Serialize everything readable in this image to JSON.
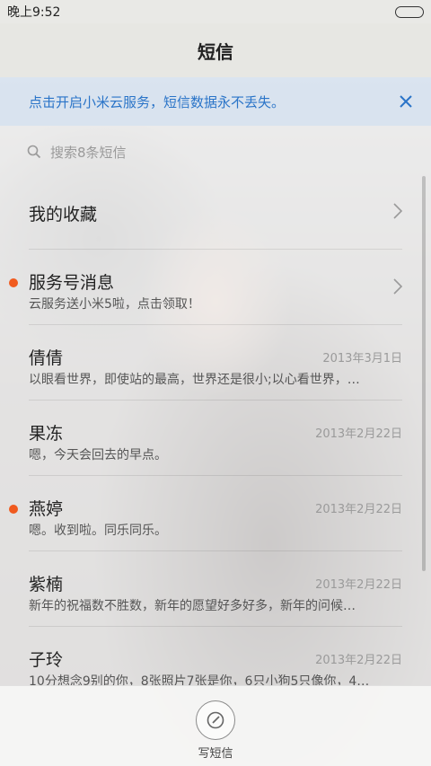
{
  "status": {
    "time": "晚上9:52",
    "battery": 1.0
  },
  "header": {
    "title": "短信"
  },
  "banner": {
    "text": "点击开启小米云服务，短信数据永不丢失。"
  },
  "search": {
    "placeholder": "搜索8条短信"
  },
  "conversations": [
    {
      "name": "我的收藏",
      "date": "",
      "preview": "",
      "unread": false,
      "chevron": true
    },
    {
      "name": "服务号消息",
      "date": "",
      "preview": "云服务送小米5啦，点击领取！",
      "unread": true,
      "chevron": true
    },
    {
      "name": "倩倩",
      "date": "2013年3月1日",
      "preview": "以眼看世界，即使站的最高，世界还是很小;以心看世界，…",
      "unread": false,
      "chevron": false
    },
    {
      "name": "果冻",
      "date": "2013年2月22日",
      "preview": "嗯，今天会回去的早点。",
      "unread": false,
      "chevron": false
    },
    {
      "name": "燕婷",
      "date": "2013年2月22日",
      "preview": "嗯。收到啦。同乐同乐。",
      "unread": true,
      "chevron": false
    },
    {
      "name": "紫楠",
      "date": "2013年2月22日",
      "preview": "新年的祝福数不胜数，新年的愿望好多好多，新年的问候…",
      "unread": false,
      "chevron": false
    },
    {
      "name": "子玲",
      "date": "2013年2月22日",
      "preview": "10分想念9别的你，8张照片7张是你，6只小狗5只像你，4…",
      "unread": false,
      "chevron": false
    }
  ],
  "bottom": {
    "compose_label": "写短信"
  },
  "colors": {
    "accent": "#2a74c8",
    "unread_dot": "#f05a1e"
  }
}
